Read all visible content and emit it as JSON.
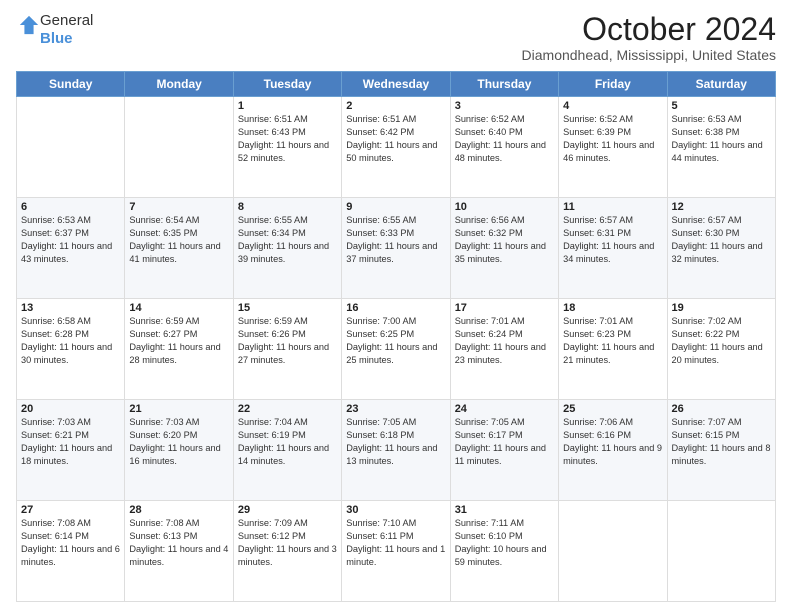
{
  "header": {
    "logo": {
      "line1": "General",
      "line2": "Blue"
    },
    "title": "October 2024",
    "location": "Diamondhead, Mississippi, United States"
  },
  "weekdays": [
    "Sunday",
    "Monday",
    "Tuesday",
    "Wednesday",
    "Thursday",
    "Friday",
    "Saturday"
  ],
  "weeks": [
    [
      {
        "day": "",
        "info": ""
      },
      {
        "day": "",
        "info": ""
      },
      {
        "day": "1",
        "info": "Sunrise: 6:51 AM\nSunset: 6:43 PM\nDaylight: 11 hours and 52 minutes."
      },
      {
        "day": "2",
        "info": "Sunrise: 6:51 AM\nSunset: 6:42 PM\nDaylight: 11 hours and 50 minutes."
      },
      {
        "day": "3",
        "info": "Sunrise: 6:52 AM\nSunset: 6:40 PM\nDaylight: 11 hours and 48 minutes."
      },
      {
        "day": "4",
        "info": "Sunrise: 6:52 AM\nSunset: 6:39 PM\nDaylight: 11 hours and 46 minutes."
      },
      {
        "day": "5",
        "info": "Sunrise: 6:53 AM\nSunset: 6:38 PM\nDaylight: 11 hours and 44 minutes."
      }
    ],
    [
      {
        "day": "6",
        "info": "Sunrise: 6:53 AM\nSunset: 6:37 PM\nDaylight: 11 hours and 43 minutes."
      },
      {
        "day": "7",
        "info": "Sunrise: 6:54 AM\nSunset: 6:35 PM\nDaylight: 11 hours and 41 minutes."
      },
      {
        "day": "8",
        "info": "Sunrise: 6:55 AM\nSunset: 6:34 PM\nDaylight: 11 hours and 39 minutes."
      },
      {
        "day": "9",
        "info": "Sunrise: 6:55 AM\nSunset: 6:33 PM\nDaylight: 11 hours and 37 minutes."
      },
      {
        "day": "10",
        "info": "Sunrise: 6:56 AM\nSunset: 6:32 PM\nDaylight: 11 hours and 35 minutes."
      },
      {
        "day": "11",
        "info": "Sunrise: 6:57 AM\nSunset: 6:31 PM\nDaylight: 11 hours and 34 minutes."
      },
      {
        "day": "12",
        "info": "Sunrise: 6:57 AM\nSunset: 6:30 PM\nDaylight: 11 hours and 32 minutes."
      }
    ],
    [
      {
        "day": "13",
        "info": "Sunrise: 6:58 AM\nSunset: 6:28 PM\nDaylight: 11 hours and 30 minutes."
      },
      {
        "day": "14",
        "info": "Sunrise: 6:59 AM\nSunset: 6:27 PM\nDaylight: 11 hours and 28 minutes."
      },
      {
        "day": "15",
        "info": "Sunrise: 6:59 AM\nSunset: 6:26 PM\nDaylight: 11 hours and 27 minutes."
      },
      {
        "day": "16",
        "info": "Sunrise: 7:00 AM\nSunset: 6:25 PM\nDaylight: 11 hours and 25 minutes."
      },
      {
        "day": "17",
        "info": "Sunrise: 7:01 AM\nSunset: 6:24 PM\nDaylight: 11 hours and 23 minutes."
      },
      {
        "day": "18",
        "info": "Sunrise: 7:01 AM\nSunset: 6:23 PM\nDaylight: 11 hours and 21 minutes."
      },
      {
        "day": "19",
        "info": "Sunrise: 7:02 AM\nSunset: 6:22 PM\nDaylight: 11 hours and 20 minutes."
      }
    ],
    [
      {
        "day": "20",
        "info": "Sunrise: 7:03 AM\nSunset: 6:21 PM\nDaylight: 11 hours and 18 minutes."
      },
      {
        "day": "21",
        "info": "Sunrise: 7:03 AM\nSunset: 6:20 PM\nDaylight: 11 hours and 16 minutes."
      },
      {
        "day": "22",
        "info": "Sunrise: 7:04 AM\nSunset: 6:19 PM\nDaylight: 11 hours and 14 minutes."
      },
      {
        "day": "23",
        "info": "Sunrise: 7:05 AM\nSunset: 6:18 PM\nDaylight: 11 hours and 13 minutes."
      },
      {
        "day": "24",
        "info": "Sunrise: 7:05 AM\nSunset: 6:17 PM\nDaylight: 11 hours and 11 minutes."
      },
      {
        "day": "25",
        "info": "Sunrise: 7:06 AM\nSunset: 6:16 PM\nDaylight: 11 hours and 9 minutes."
      },
      {
        "day": "26",
        "info": "Sunrise: 7:07 AM\nSunset: 6:15 PM\nDaylight: 11 hours and 8 minutes."
      }
    ],
    [
      {
        "day": "27",
        "info": "Sunrise: 7:08 AM\nSunset: 6:14 PM\nDaylight: 11 hours and 6 minutes."
      },
      {
        "day": "28",
        "info": "Sunrise: 7:08 AM\nSunset: 6:13 PM\nDaylight: 11 hours and 4 minutes."
      },
      {
        "day": "29",
        "info": "Sunrise: 7:09 AM\nSunset: 6:12 PM\nDaylight: 11 hours and 3 minutes."
      },
      {
        "day": "30",
        "info": "Sunrise: 7:10 AM\nSunset: 6:11 PM\nDaylight: 11 hours and 1 minute."
      },
      {
        "day": "31",
        "info": "Sunrise: 7:11 AM\nSunset: 6:10 PM\nDaylight: 10 hours and 59 minutes."
      },
      {
        "day": "",
        "info": ""
      },
      {
        "day": "",
        "info": ""
      }
    ]
  ]
}
